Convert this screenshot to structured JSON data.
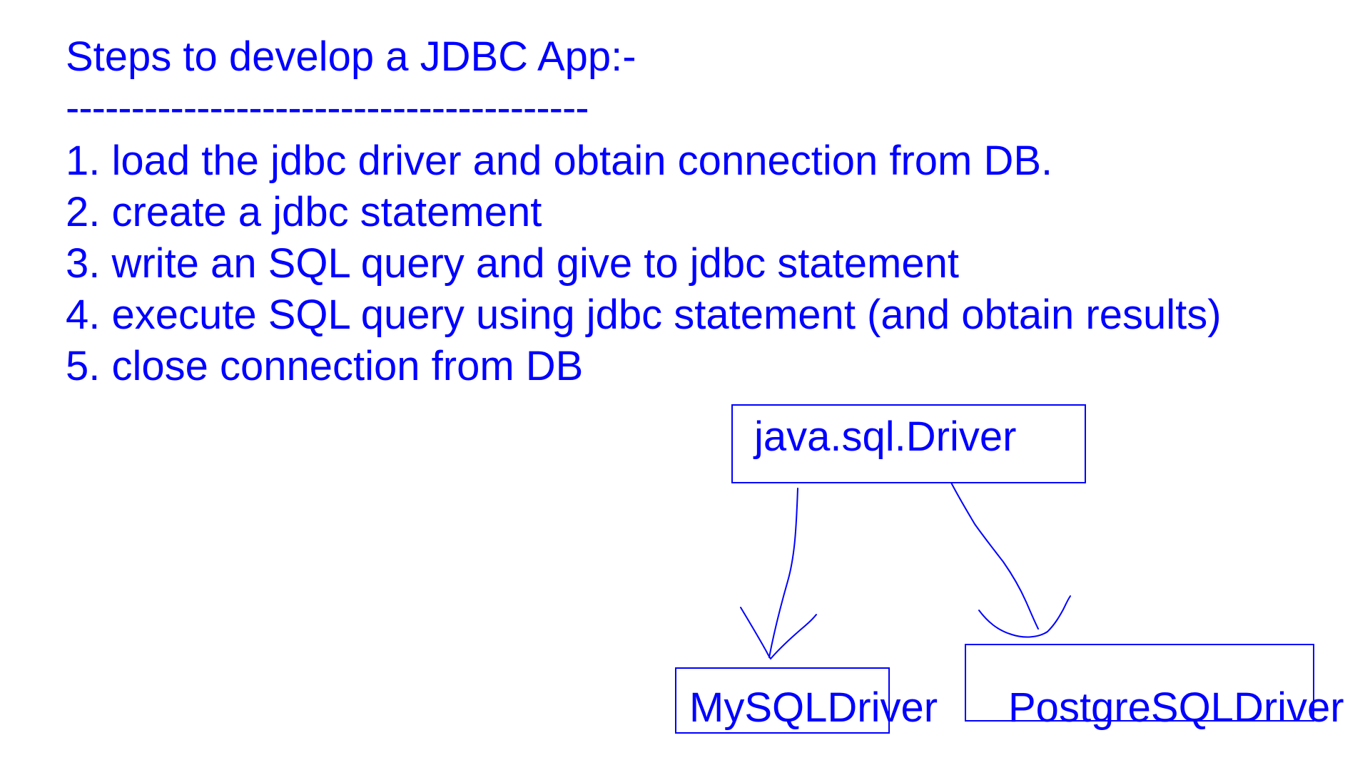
{
  "heading": {
    "title": "Steps to develop a JDBC App:-",
    "rule": "----------------------------------------"
  },
  "steps": [
    "1. load the jdbc driver  and obtain connection from DB.",
    "2. create a jdbc statement",
    "3. write an SQL query and give to jdbc statement",
    "4. execute SQL query using jdbc statement (and obtain results)",
    "5. close connection from DB"
  ],
  "diagram": {
    "parent": "java.sql.Driver",
    "children": [
      "MySQLDriver",
      "PostgreSQLDriver"
    ],
    "stroke_color": "#0000ff"
  }
}
